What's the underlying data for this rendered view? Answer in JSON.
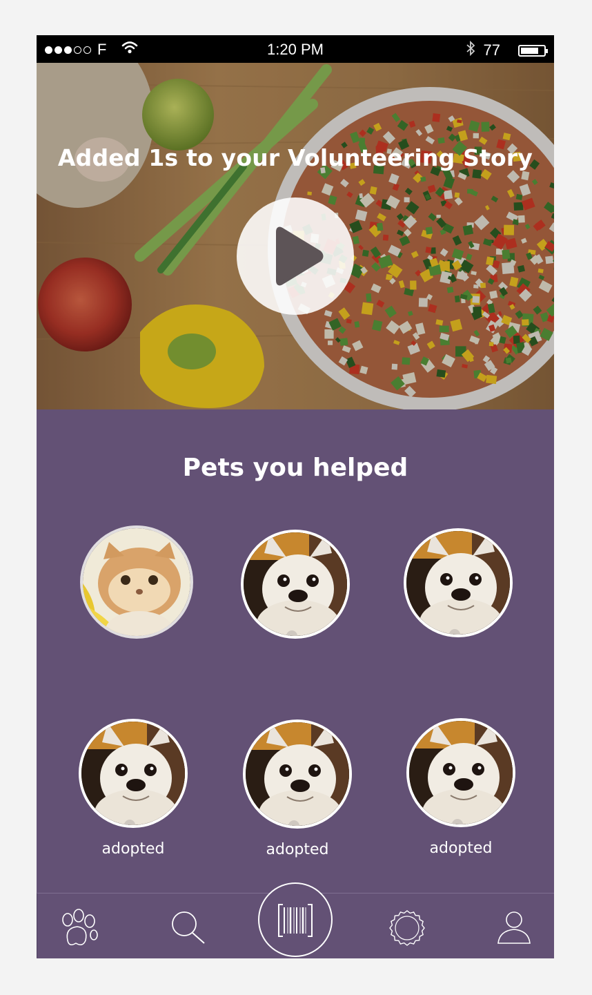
{
  "status_bar": {
    "carrier": "F",
    "time": "1:20 PM",
    "battery": "77",
    "battery_level": 0.77,
    "signal_bars": 3,
    "signal_max": 5
  },
  "hero": {
    "title": "Added 1s to your Volunteering Story",
    "play_icon": "play-icon"
  },
  "pets_section": {
    "title": "Pets you helped",
    "pets": [
      {
        "animal": "cat",
        "status": ""
      },
      {
        "animal": "dog",
        "status": ""
      },
      {
        "animal": "dog",
        "status": ""
      },
      {
        "animal": "dog",
        "status": "adopted"
      },
      {
        "animal": "dog",
        "status": "adopted"
      },
      {
        "animal": "dog",
        "status": "adopted"
      }
    ]
  },
  "tab_bar": {
    "items": [
      "paw-icon",
      "search-icon",
      "barcode-scan-icon",
      "badge-icon",
      "profile-icon"
    ]
  },
  "colors": {
    "panel": "#635175",
    "statusbar": "#000000",
    "page_bg": "#f3f3f3"
  }
}
